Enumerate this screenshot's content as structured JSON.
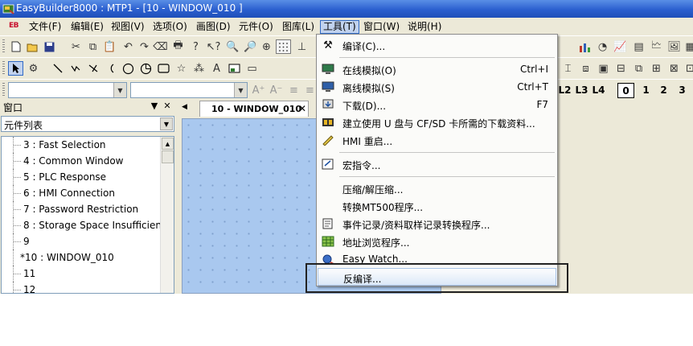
{
  "window": {
    "title": "EasyBuilder8000 : MTP1 - [10 - WINDOW_010 ]"
  },
  "menubar": {
    "logo": "EB",
    "items": [
      "文件(F)",
      "编辑(E)",
      "视图(V)",
      "选项(O)",
      "画图(D)",
      "元件(O)",
      "图库(L)",
      "工具(T)",
      "窗口(W)",
      "说明(H)"
    ]
  },
  "layer_buttons": [
    "L2",
    "L3",
    "L4",
    "0",
    "1",
    "2",
    "3"
  ],
  "left_pane": {
    "title": "窗口",
    "selector_value": "元件列表",
    "tree_items": [
      "3 : Fast Selection",
      "4 : Common Window",
      "5 : PLC Response",
      "6 : HMI Connection",
      "7 : Password Restriction",
      "8 : Storage Space Insufficient",
      "9",
      "*10 : WINDOW_010",
      "11",
      "12"
    ]
  },
  "tab": {
    "label": "10 - WINDOW_010"
  },
  "tools_menu": {
    "items": [
      {
        "label": "编译(C)...",
        "shortcut": "",
        "icon": "hammer-icon"
      },
      {
        "label": "在线模拟(O)",
        "shortcut": "Ctrl+I",
        "icon": "monitor-online-icon"
      },
      {
        "label": "离线模拟(S)",
        "shortcut": "Ctrl+T",
        "icon": "monitor-offline-icon"
      },
      {
        "label": "下载(D)...",
        "shortcut": "F7",
        "icon": "download-icon"
      },
      {
        "label": "建立使用 U 盘与 CF/SD 卡所需的下载资料...",
        "shortcut": "",
        "icon": "memory-card-icon"
      },
      {
        "label": "HMI 重启...",
        "shortcut": "",
        "icon": "restart-icon"
      },
      {
        "label": "宏指令...",
        "shortcut": "",
        "icon": "macro-icon"
      },
      {
        "label": "压缩/解压缩...",
        "shortcut": "",
        "icon": ""
      },
      {
        "label": "转换MT500程序...",
        "shortcut": "",
        "icon": ""
      },
      {
        "label": "事件记录/资料取样记录转换程序...",
        "shortcut": "",
        "icon": "event-log-icon"
      },
      {
        "label": "地址浏览程序...",
        "shortcut": "",
        "icon": "address-table-icon"
      },
      {
        "label": "Easy Watch...",
        "shortcut": "",
        "icon": "easy-watch-icon"
      },
      {
        "label": "反编译...",
        "shortcut": "",
        "icon": ""
      }
    ]
  }
}
